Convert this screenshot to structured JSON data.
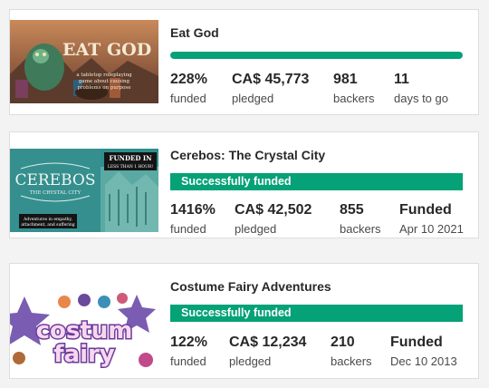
{
  "projects": [
    {
      "title": "Eat God",
      "thumb_text": "EAT GOD",
      "thumb_tagline": [
        "a tabletop roleplaying",
        "game about causing",
        "problems on purpose"
      ],
      "progress_fraction": 1.0,
      "stats": [
        {
          "value": "228%",
          "label": "funded"
        },
        {
          "value": "CA$ 45,773",
          "label": "pledged"
        },
        {
          "value": "981",
          "label": "backers"
        },
        {
          "value": "11",
          "label": "days to go"
        }
      ]
    },
    {
      "title": "Cerebos: The Crystal City",
      "thumb_text": "CEREBOS",
      "thumb_subtext": "THE CRYSTAL CITY",
      "thumb_badge": [
        "FUNDED IN",
        "LESS THAN 1 HOUR!"
      ],
      "thumb_caption": [
        "Adventures in empathy,",
        "attachment, and suffering"
      ],
      "status": "Successfully funded",
      "stats": [
        {
          "value": "1416%",
          "label": "funded"
        },
        {
          "value": "CA$ 42,502",
          "label": "pledged"
        },
        {
          "value": "855",
          "label": "backers"
        },
        {
          "value": "Funded",
          "label": "Apr 10 2021"
        }
      ]
    },
    {
      "title": "Costume Fairy Adventures",
      "thumb_text": [
        "costum",
        "fairy"
      ],
      "status": "Successfully funded",
      "stats": [
        {
          "value": "122%",
          "label": "funded"
        },
        {
          "value": "CA$ 12,234",
          "label": "pledged"
        },
        {
          "value": "210",
          "label": "backers"
        },
        {
          "value": "Funded",
          "label": "Dec 10 2013"
        }
      ]
    }
  ],
  "colors": {
    "accent_green": "#05a177",
    "card_border": "#dcdedd",
    "page_bg": "#f3f3f3"
  }
}
